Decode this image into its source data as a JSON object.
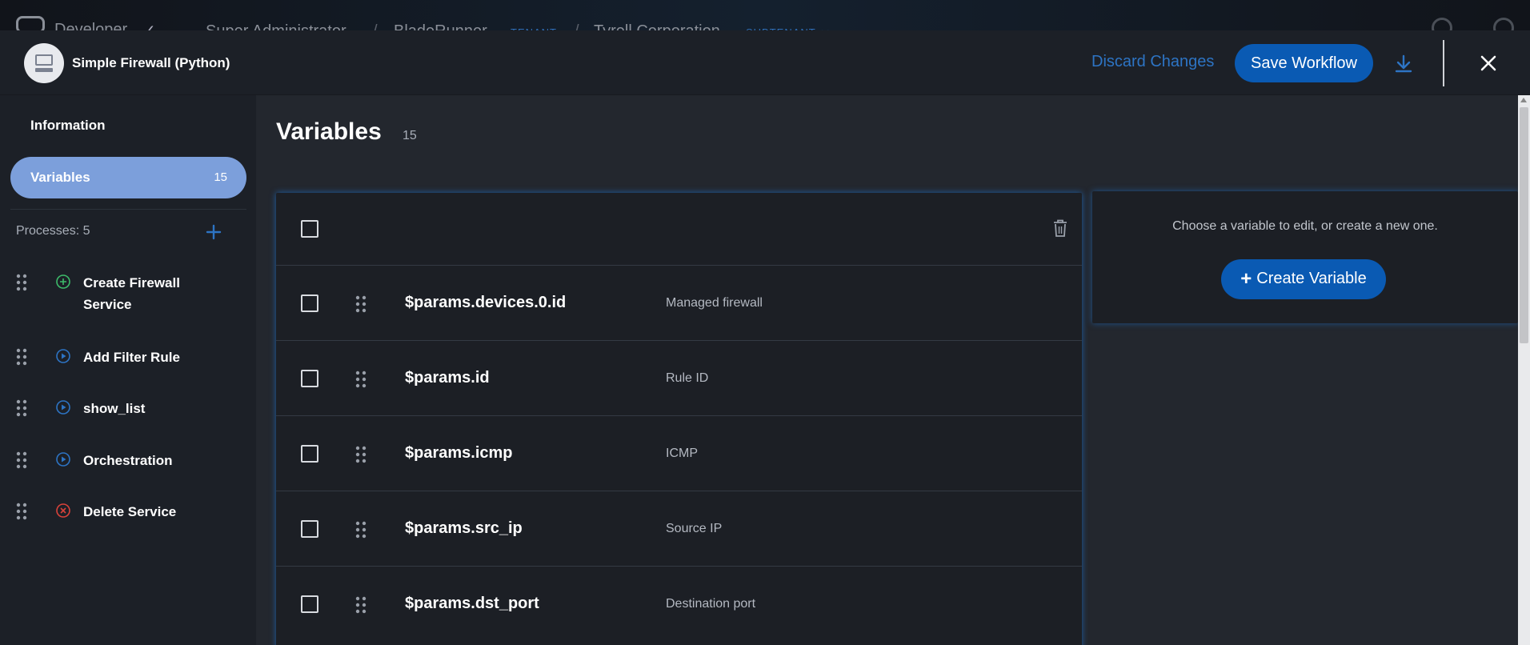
{
  "background_bar": {
    "app_name": "Developer",
    "crumbs": [
      {
        "label": "Super Administrator"
      },
      {
        "label": "BladeRunner"
      },
      {
        "label": "TENANT"
      },
      {
        "label": "Tyrell Corporation"
      },
      {
        "label": "SUBTENANT ↑↓"
      }
    ]
  },
  "header": {
    "workflow_title": "Simple Firewall (Python)",
    "discard_label": "Discard Changes",
    "save_label": "Save Workflow"
  },
  "sidebar": {
    "information_label": "Information",
    "variables_label": "Variables",
    "variables_count": "15",
    "processes_label": "Processes: 5",
    "processes": [
      {
        "label": "Create Firewall Service",
        "type": "create",
        "color": "#3dbb6a"
      },
      {
        "label": "Add Filter Rule",
        "type": "update",
        "color": "#2d74c4"
      },
      {
        "label": "show_list",
        "type": "update",
        "color": "#2d74c4"
      },
      {
        "label": "Orchestration",
        "type": "update",
        "color": "#2d74c4"
      },
      {
        "label": "Delete Service",
        "type": "delete",
        "color": "#d9423a"
      }
    ]
  },
  "main": {
    "title": "Variables",
    "count": "15",
    "variables": [
      {
        "name": "$params.devices.0.id",
        "description": "Managed firewall"
      },
      {
        "name": "$params.id",
        "description": "Rule ID"
      },
      {
        "name": "$params.icmp",
        "description": "ICMP"
      },
      {
        "name": "$params.src_ip",
        "description": "Source IP"
      },
      {
        "name": "$params.dst_port",
        "description": "Destination port"
      }
    ]
  },
  "editor": {
    "message": "Choose a variable to edit, or create a new one.",
    "create_label": "Create Variable"
  },
  "colors": {
    "accent": "#0a5ab3",
    "link": "#2d74c4",
    "active_nav": "#7c9fdb"
  }
}
